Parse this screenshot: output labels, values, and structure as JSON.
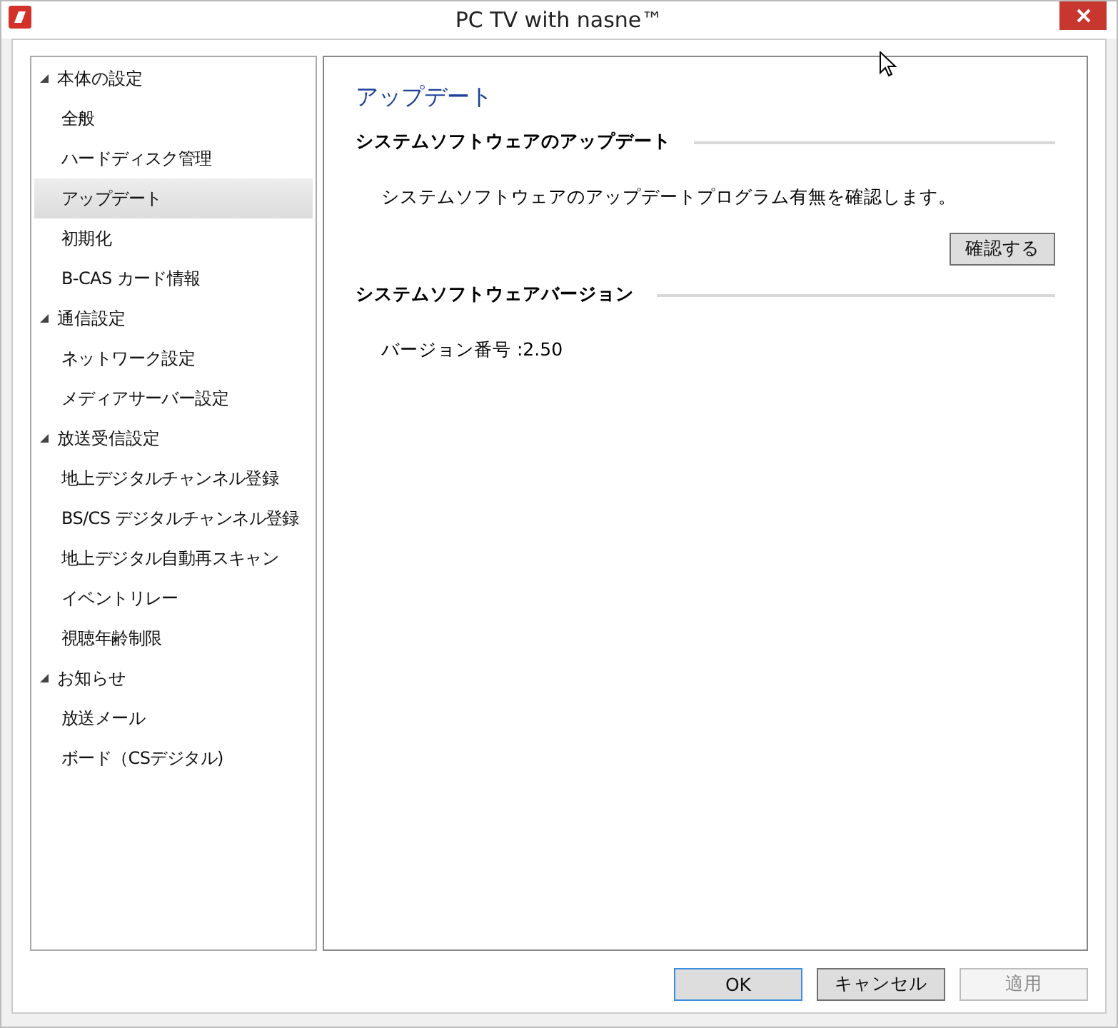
{
  "window": {
    "title": "PC TV with nasne™"
  },
  "sidebar": {
    "groups": [
      {
        "label": "本体の設定",
        "expanded": true,
        "children": [
          {
            "label": "全般",
            "selected": false
          },
          {
            "label": "ハードディスク管理",
            "selected": false
          },
          {
            "label": "アップデート",
            "selected": true
          },
          {
            "label": "初期化",
            "selected": false
          },
          {
            "label": "B-CAS カード情報",
            "selected": false
          }
        ]
      },
      {
        "label": "通信設定",
        "expanded": true,
        "children": [
          {
            "label": "ネットワーク設定",
            "selected": false
          },
          {
            "label": "メディアサーバー設定",
            "selected": false
          }
        ]
      },
      {
        "label": "放送受信設定",
        "expanded": true,
        "children": [
          {
            "label": "地上デジタルチャンネル登録",
            "selected": false
          },
          {
            "label": "BS/CS デジタルチャンネル登録",
            "selected": false
          },
          {
            "label": "地上デジタル自動再スキャン",
            "selected": false
          },
          {
            "label": "イベントリレー",
            "selected": false
          },
          {
            "label": "視聴年齢制限",
            "selected": false
          }
        ]
      },
      {
        "label": "お知らせ",
        "expanded": true,
        "children": [
          {
            "label": "放送メール",
            "selected": false
          },
          {
            "label": "ボード（CSデジタル)",
            "selected": false
          }
        ]
      }
    ]
  },
  "content": {
    "title": "アップデート",
    "sections": [
      {
        "heading": "システムソフトウェアのアップデート",
        "text": "システムソフトウェアのアップデートプログラム有無を確認します。",
        "button": "確認する"
      },
      {
        "heading": "システムソフトウェアバージョン",
        "text": "バージョン番号  :2.50"
      }
    ]
  },
  "buttons": [
    {
      "label": "OK",
      "disabled": false,
      "focused": true
    },
    {
      "label": "キャンセル",
      "disabled": false,
      "focused": false
    },
    {
      "label": "適用",
      "disabled": true,
      "focused": false
    }
  ]
}
